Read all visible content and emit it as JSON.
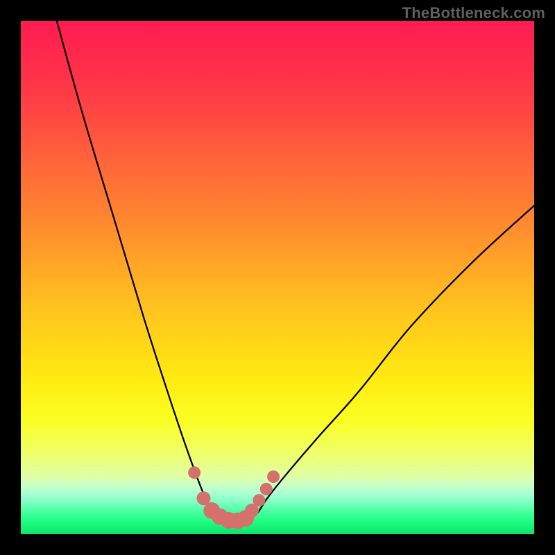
{
  "watermark": "TheBottleneck.com",
  "colors": {
    "frame": "#000000",
    "watermark": "#5f5f5f",
    "curve": "#000000",
    "marker_fill": "#d5716d",
    "marker_stroke": "#c95d58",
    "gradient_stops": [
      {
        "offset": 0.0,
        "color": "#ff1b52"
      },
      {
        "offset": 0.12,
        "color": "#ff3448"
      },
      {
        "offset": 0.26,
        "color": "#ff603b"
      },
      {
        "offset": 0.4,
        "color": "#ff8b2e"
      },
      {
        "offset": 0.55,
        "color": "#ffc01f"
      },
      {
        "offset": 0.7,
        "color": "#ffeb11"
      },
      {
        "offset": 0.78,
        "color": "#fbff24"
      },
      {
        "offset": 0.84,
        "color": "#efff67"
      },
      {
        "offset": 0.885,
        "color": "#e1ffa3"
      },
      {
        "offset": 0.905,
        "color": "#caffc7"
      },
      {
        "offset": 0.922,
        "color": "#a6ffd4"
      },
      {
        "offset": 0.94,
        "color": "#78ffbf"
      },
      {
        "offset": 0.958,
        "color": "#43ff9a"
      },
      {
        "offset": 0.978,
        "color": "#1bfc7e"
      },
      {
        "offset": 1.0,
        "color": "#0fe26b"
      }
    ]
  },
  "chart_data": {
    "type": "line",
    "title": "",
    "xlabel": "",
    "ylabel": "",
    "xlim": [
      0,
      100
    ],
    "ylim": [
      0,
      100
    ],
    "grid": false,
    "legend": false,
    "series": [
      {
        "name": "bottleneck_curve",
        "x": [
          7,
          12,
          18,
          24,
          28.5,
          31.5,
          34,
          36,
          38,
          40,
          42,
          44,
          46,
          48,
          52,
          58,
          66,
          76,
          88,
          100
        ],
        "values": [
          100,
          82,
          62,
          42,
          28,
          19,
          12,
          7,
          4,
          2.7,
          2.4,
          2.7,
          4,
          7,
          12,
          19,
          28,
          40.5,
          53,
          64
        ]
      }
    ],
    "markers": [
      {
        "x": 33.8,
        "y": 12.0,
        "r": 1.5
      },
      {
        "x": 35.6,
        "y": 7.0,
        "r": 1.5
      },
      {
        "x": 37.2,
        "y": 4.6,
        "r": 1.8
      },
      {
        "x": 38.8,
        "y": 3.4,
        "r": 1.8
      },
      {
        "x": 40.5,
        "y": 2.7,
        "r": 1.8
      },
      {
        "x": 42.2,
        "y": 2.6,
        "r": 1.8
      },
      {
        "x": 43.8,
        "y": 3.1,
        "r": 1.8
      },
      {
        "x": 45.0,
        "y": 4.6,
        "r": 1.5
      },
      {
        "x": 46.4,
        "y": 6.6,
        "r": 1.5
      },
      {
        "x": 47.8,
        "y": 8.8,
        "r": 1.5
      },
      {
        "x": 49.2,
        "y": 11.2,
        "r": 1.5
      }
    ],
    "annotations": []
  }
}
